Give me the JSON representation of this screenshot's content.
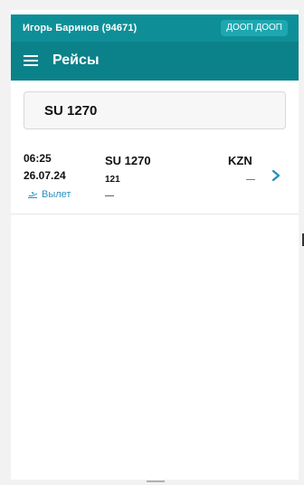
{
  "status_bar": {
    "user": "Игорь Баринов (94671)",
    "org_badge": "ДООП ДООП"
  },
  "app_bar": {
    "title": "Рейсы",
    "menu_icon": "hamburger-menu-icon"
  },
  "search": {
    "value": "SU 1270"
  },
  "flights": [
    {
      "time": "06:25",
      "date": "26.07.24",
      "direction_label": "Вылет",
      "direction_icon": "plane-takeoff-icon",
      "flight_number": "SU 1270",
      "secondary_number": "121",
      "secondary_dash": "—",
      "destination": "KZN",
      "destination_dash": "—",
      "action_icon": "chevron-right-icon"
    }
  ],
  "colors": {
    "status_bar": "#0e8f97",
    "app_bar": "#0b8189",
    "accent": "#2a8fc0",
    "top_stripe": "#f2d34e"
  }
}
